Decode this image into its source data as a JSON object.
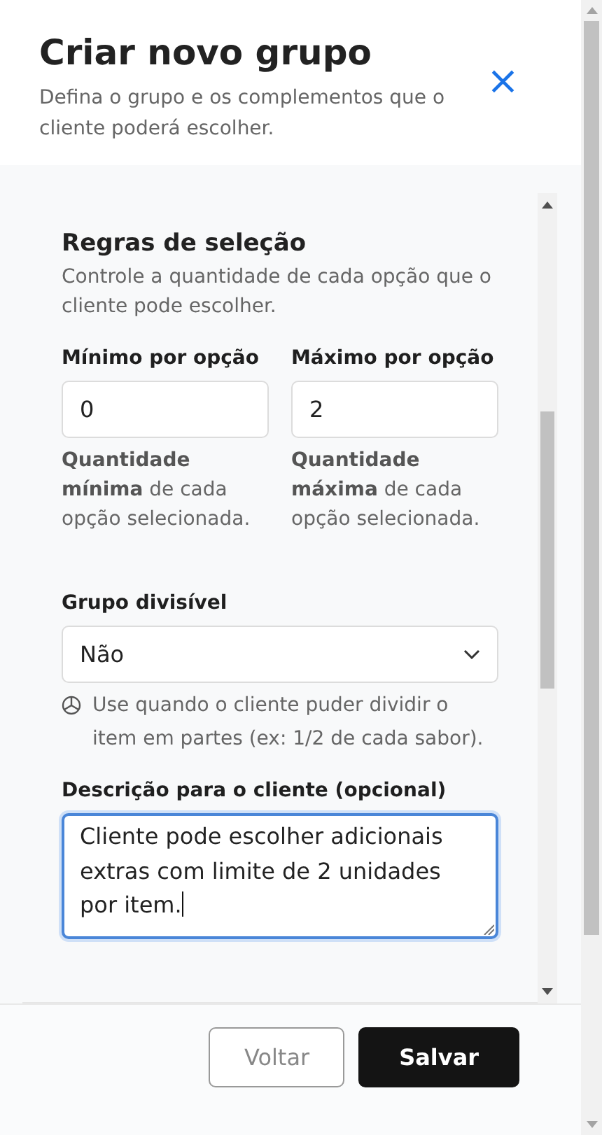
{
  "header": {
    "title": "Criar novo grupo",
    "subtitle": "Defina o grupo e os complementos que o cliente poderá escolher.",
    "close": "×"
  },
  "section": {
    "title": "Regras de seleção",
    "description": "Controle a quantidade de cada opção que o cliente pode escolher."
  },
  "limits": [
    {
      "label": "Mínimo por opção",
      "value": "0",
      "hint": "**Quantidade mínima** de cada opção selecionada."
    },
    {
      "label": "Máximo por opção",
      "value": "2",
      "hint": "**Quantidade máxima** de cada opção selecionada."
    }
  ],
  "divisible": {
    "label": "Grupo divisível",
    "value": "Não",
    "hint": "Use quando o cliente puder dividir o item em partes (ex: 1/2 de cada sabor)."
  },
  "description": {
    "label": "Descrição para o cliente (opcional)",
    "value": "Cliente pode escolher adicionais extras com limite de 2 unidades por item.",
    "focused": true
  },
  "buttons": [
    {
      "label": "Voltar",
      "kind": "secondary"
    },
    {
      "label": "Salvar",
      "kind": "primary"
    }
  ]
}
